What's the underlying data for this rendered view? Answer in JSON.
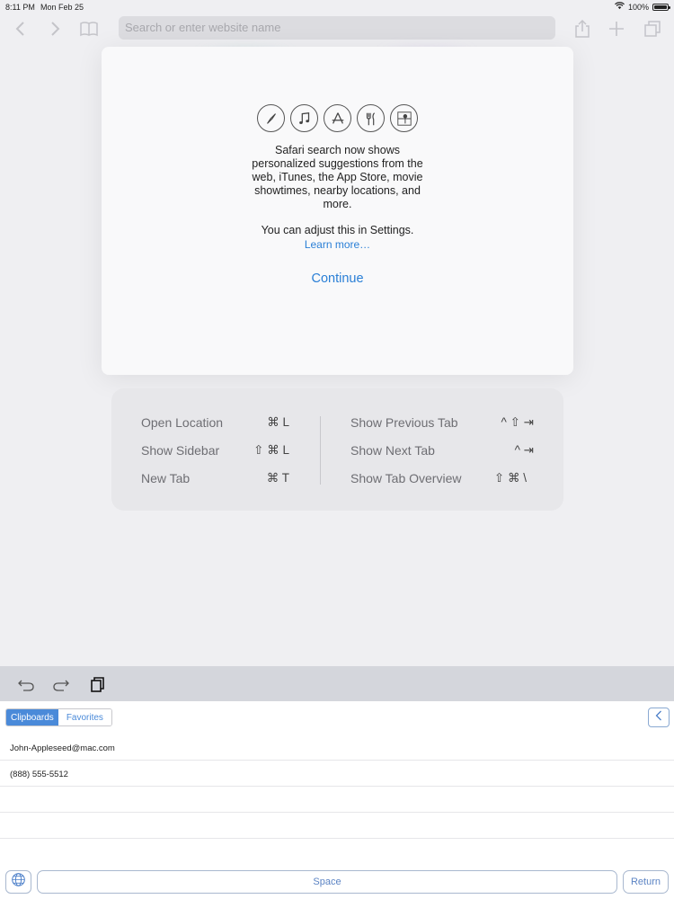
{
  "status_bar": {
    "time": "8:11 PM",
    "date": "Mon Feb 25",
    "battery": "100%",
    "wifi_icon": "wifi-icon",
    "battery_level": 1.0
  },
  "toolbar": {
    "search_placeholder": "Search or enter website name",
    "icons": [
      "back-icon",
      "forward-icon",
      "bookmarks-icon",
      "share-icon",
      "new-tab-icon",
      "tabs-icon"
    ]
  },
  "popup": {
    "icons": [
      "compass-icon",
      "music-note-icon",
      "app-store-icon",
      "fork-knife-icon",
      "map-pin-icon"
    ],
    "message_lines": [
      "Safari search now shows",
      "personalized suggestions from the",
      "web, iTunes, the App Store, movie",
      "showtimes, nearby locations, and",
      "more."
    ],
    "adjust_text": "You can adjust this in Settings.",
    "learn_more": "Learn more…",
    "continue_label": "Continue"
  },
  "shortcuts": {
    "left": [
      {
        "label": "Open Location",
        "keys": "⌘ L"
      },
      {
        "label": "Show Sidebar",
        "keys": "⇧ ⌘ L"
      },
      {
        "label": "New Tab",
        "keys": "⌘ T"
      }
    ],
    "right": [
      {
        "label": "Show Previous Tab",
        "keys": "^ ⇧ ⇥"
      },
      {
        "label": "Show Next Tab",
        "keys": "^ ⇥"
      },
      {
        "label": "Show Tab Overview",
        "keys": "⇧ ⌘ \\"
      }
    ]
  },
  "accessory_bar": {
    "icons": [
      "undo-icon",
      "redo-icon",
      "paste-icon"
    ]
  },
  "clipboard_panel": {
    "tabs": [
      "Clipboards",
      "Favorites"
    ],
    "selected_tab": "Clipboards",
    "items": [
      "John-Appleseed@mac.com",
      "(888) 555-5512"
    ],
    "space_label": "Space",
    "return_label": "Return"
  }
}
